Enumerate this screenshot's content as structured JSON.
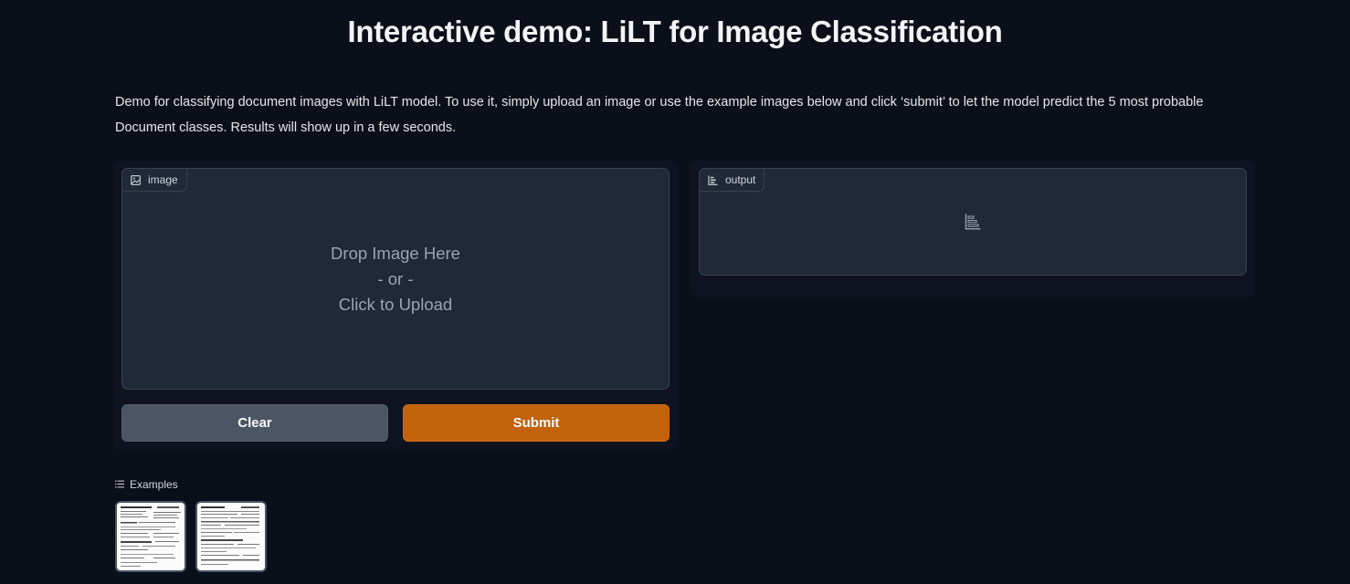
{
  "header": {
    "title": "Interactive demo: LiLT for Image Classification",
    "description": "Demo for classifying document images with LiLT model. To use it, simply upload an image or use the example images below and click ‘submit’ to let the model predict the 5 most probable Document classes. Results will show up in a few seconds."
  },
  "input": {
    "label": "image",
    "label_icon": "image-icon",
    "drop_line1": "Drop Image Here",
    "drop_line2": "- or -",
    "drop_line3": "Click to Upload"
  },
  "output": {
    "label": "output",
    "label_icon": "bar-chart-icon",
    "empty_icon": "bar-chart-icon"
  },
  "buttons": {
    "clear": "Clear",
    "submit": "Submit"
  },
  "examples": {
    "label": "Examples",
    "label_icon": "list-icon",
    "items": [
      "example-document-1",
      "example-document-2"
    ]
  },
  "colors": {
    "background": "#0b0f19",
    "block": "#1f2937",
    "clear_button": "#4b5563",
    "submit_button": "#c2620a"
  }
}
